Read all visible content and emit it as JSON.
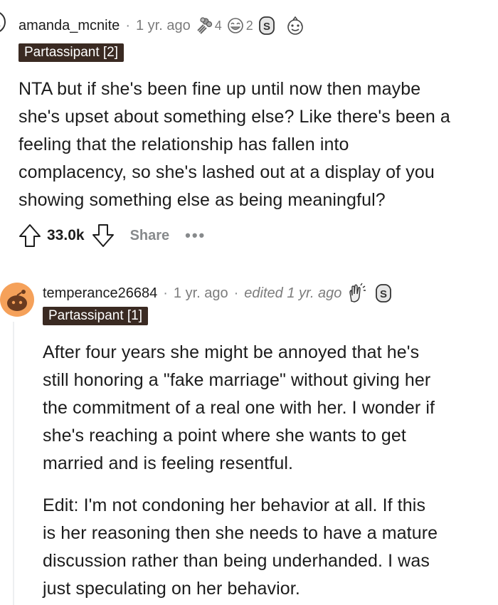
{
  "comments": [
    {
      "username": "amanda_mcnite",
      "time": "1 yr. ago",
      "awards": [
        {
          "icon": "bouquet-award-icon",
          "count": "4"
        },
        {
          "icon": "laughing-award-icon",
          "count": "2"
        },
        {
          "icon": "silver-coin-icon",
          "count": ""
        },
        {
          "icon": "wholesome-face-icon",
          "count": ""
        }
      ],
      "flair": "Partassipant [2]",
      "body": "NTA but if she's been fine up until now then maybe\nshe's upset about something else? Like there's been a\nfeeling that the relationship has fallen into\ncomplacency, so she's lashed out at a display of you\nshowing something else as being meaningful?",
      "score": "33.0k",
      "share_label": "Share",
      "more_label": "•••"
    },
    {
      "username": "temperance26684",
      "time": "1 yr. ago",
      "edited": "edited 1 yr. ago",
      "awards": [
        {
          "icon": "clapping-hands-icon",
          "count": ""
        },
        {
          "icon": "silver-coin-icon",
          "count": ""
        }
      ],
      "flair": "Partassipant [1]",
      "paragraphs": [
        "After four years she might be annoyed that he's\nstill honoring a \"fake marriage\" without giving her\nthe commitment of a real one with her. I wonder if\nshe's reaching a point where she wants to get\nmarried and is feeling resentful.",
        "Edit: I'm not condoning her behavior at all. If this\nis her reasoning then she needs to have a mature\ndiscussion rather than being underhanded. I was\njust speculating on her behavior."
      ]
    }
  ],
  "colors": {
    "flair_bg": "#3a2a22",
    "avatar_bg": "#f5a15a",
    "muted": "#878a8c"
  }
}
